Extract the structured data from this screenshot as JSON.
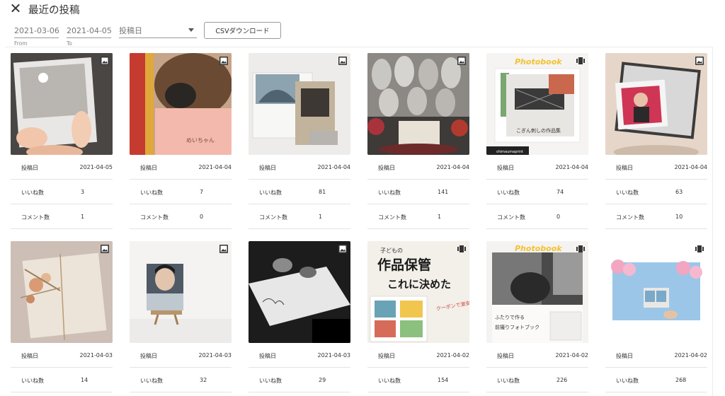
{
  "header": {
    "title": "最近の投稿"
  },
  "filters": {
    "from_value": "2021-03-06",
    "from_hint": "From",
    "to_value": "2021-04-05",
    "to_hint": "To",
    "sort_value": "投稿日",
    "csv_label": "CSVダウンロード"
  },
  "labels": {
    "date": "投稿日",
    "likes": "いいね数",
    "comments": "コメント数"
  },
  "posts": [
    {
      "date": "2021-04-05",
      "likes": "3",
      "comments": "1",
      "media": "image-icon"
    },
    {
      "date": "2021-04-04",
      "likes": "7",
      "comments": "0",
      "media": "image-icon"
    },
    {
      "date": "2021-04-04",
      "likes": "81",
      "comments": "1",
      "media": "image-icon"
    },
    {
      "date": "2021-04-04",
      "likes": "141",
      "comments": "1",
      "media": "image-icon"
    },
    {
      "date": "2021-04-04",
      "likes": "74",
      "comments": "0",
      "media": "carousel-icon"
    },
    {
      "date": "2021-04-04",
      "likes": "63",
      "comments": "10",
      "media": "image-icon"
    },
    {
      "date": "2021-04-03",
      "likes": "14",
      "media": "image-icon"
    },
    {
      "date": "2021-04-03",
      "likes": "32",
      "media": "image-icon"
    },
    {
      "date": "2021-04-03",
      "likes": "29",
      "media": "image-icon"
    },
    {
      "date": "2021-04-02",
      "likes": "154",
      "media": "carousel-icon"
    },
    {
      "date": "2021-04-02",
      "likes": "226",
      "media": "carousel-icon"
    },
    {
      "date": "2021-04-02",
      "likes": "268",
      "media": "carousel-icon"
    }
  ],
  "thumb_texts": {
    "t2": "めいちゃん",
    "t5_brand": "Photobook",
    "t5_caption": "こぎん刺しの作品集",
    "t5_handle": "shimaumaprint",
    "t10_title1": "作品保管",
    "t10_title2": "これに決めた",
    "t10_kodomo": "子どもの",
    "t10_coupon": "クーポンで激安!",
    "t11_brand": "Photobook",
    "t11_line1": "ふたりで作る",
    "t11_line2": "前撮りフォトブック"
  }
}
